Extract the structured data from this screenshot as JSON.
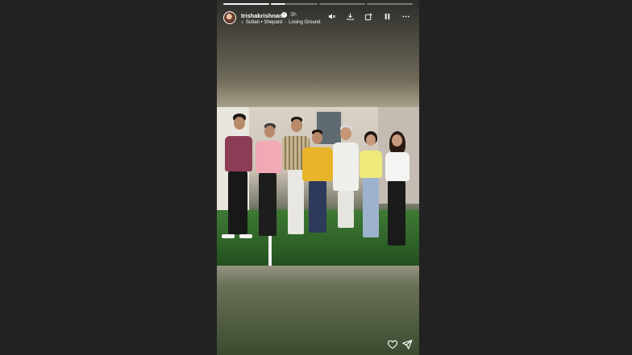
{
  "story": {
    "username": "trishakrishnan",
    "time": "3h",
    "music_artist": "Sultan • Shepard",
    "music_separator": "·",
    "music_song": "Losing Ground"
  },
  "icons": {
    "verified": "verified-badge-icon",
    "music": "music-note-icon",
    "mute": "mute-icon",
    "save": "download-icon",
    "add": "add-story-icon",
    "pause": "pause-icon",
    "more": "more-icon",
    "like": "heart-icon",
    "share": "share-icon"
  },
  "progress": {
    "segments": 4,
    "current_index": 1,
    "current_fraction": 0.3
  },
  "colors": {
    "page_background": "#222222",
    "story_gradient_top": "#2c2c2a",
    "story_gradient_mid": "#b6af98",
    "story_gradient_bottom": "#3b4a2f",
    "accent_white": "#ffffff"
  }
}
